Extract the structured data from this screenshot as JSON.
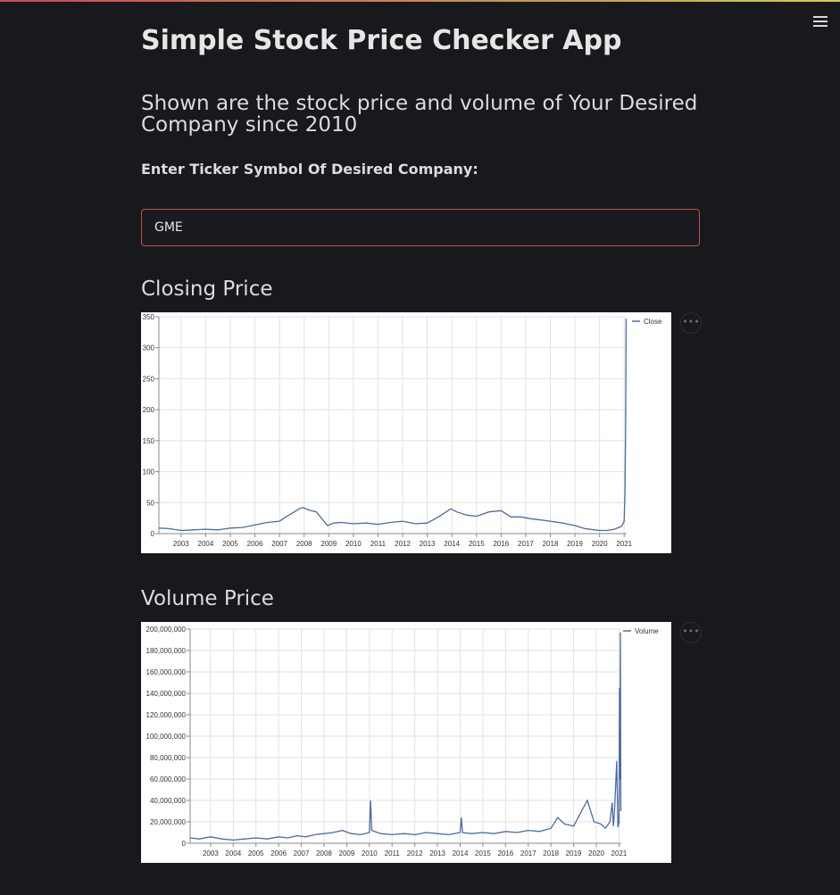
{
  "app": {
    "title": "Simple Stock Price Checker App",
    "subtitle": "Shown are the stock price and volume of Your Desired Company since 2010",
    "input_label": "Enter Ticker Symbol Of Desired Company:",
    "ticker_value": "GME",
    "menu_icon": "hamburger-menu-icon",
    "more_icon": "more-horizontal-icon"
  },
  "closing": {
    "heading": "Closing Price"
  },
  "volume": {
    "heading": "Volume Price"
  },
  "chart_data": [
    {
      "type": "line",
      "legend": [
        "Close"
      ],
      "legend_position": "top-right",
      "grid": true,
      "xlim": [
        2002.1,
        2021.1
      ],
      "ylim": [
        0,
        350
      ],
      "x_ticks": [
        "2003",
        "2004",
        "2005",
        "2006",
        "2007",
        "2008",
        "2009",
        "2010",
        "2011",
        "2012",
        "2013",
        "2014",
        "2015",
        "2016",
        "2017",
        "2018",
        "2019",
        "2020",
        "2021"
      ],
      "y_ticks": [
        "0",
        "50",
        "100",
        "150",
        "200",
        "250",
        "300",
        "350"
      ],
      "series": [
        {
          "name": "Close",
          "color": "#4c6aa3",
          "x": [
            2002.1,
            2002.5,
            2003.0,
            2003.5,
            2004.0,
            2004.5,
            2005.0,
            2005.5,
            2006.0,
            2006.5,
            2007.0,
            2007.3,
            2007.6,
            2007.8,
            2007.95,
            2008.2,
            2008.5,
            2008.8,
            2008.95,
            2009.2,
            2009.5,
            2010.0,
            2010.5,
            2011.0,
            2011.5,
            2012.0,
            2012.5,
            2013.0,
            2013.5,
            2013.95,
            2014.2,
            2014.6,
            2015.0,
            2015.5,
            2016.0,
            2016.4,
            2016.8,
            2017.2,
            2017.6,
            2018.0,
            2018.5,
            2019.0,
            2019.4,
            2019.8,
            2020.0,
            2020.3,
            2020.6,
            2020.9,
            2021.0,
            2021.03,
            2021.06,
            2021.08
          ],
          "y": [
            9,
            8,
            5,
            6,
            7,
            6,
            9,
            10,
            14,
            18,
            20,
            28,
            35,
            40,
            42,
            38,
            35,
            20,
            13,
            17,
            18,
            16,
            17,
            15,
            18,
            20,
            16,
            17,
            28,
            40,
            35,
            30,
            28,
            35,
            37,
            27,
            27,
            24,
            22,
            20,
            17,
            13,
            8,
            6,
            5,
            5,
            7,
            12,
            20,
            65,
            180,
            347
          ]
        }
      ]
    },
    {
      "type": "line",
      "legend": [
        "Volume"
      ],
      "legend_position": "top-right",
      "grid": true,
      "xlim": [
        2002.1,
        2021.1
      ],
      "ylim": [
        0,
        200000000
      ],
      "x_ticks": [
        "2003",
        "2004",
        "2005",
        "2006",
        "2007",
        "2008",
        "2009",
        "2010",
        "2011",
        "2012",
        "2013",
        "2014",
        "2015",
        "2016",
        "2017",
        "2018",
        "2019",
        "2020",
        "2021"
      ],
      "y_ticks": [
        "0",
        "20,000,000",
        "40,000,000",
        "60,000,000",
        "80,000,000",
        "100,000,000",
        "120,000,000",
        "140,000,000",
        "160,000,000",
        "180,000,000",
        "200,000,000"
      ],
      "series": [
        {
          "name": "Volume",
          "color": "#4c6aa3",
          "x": [
            2002.1,
            2002.5,
            2003.0,
            2003.5,
            2004.0,
            2004.5,
            2005.0,
            2005.5,
            2006.0,
            2006.4,
            2006.8,
            2007.2,
            2007.6,
            2008.0,
            2008.4,
            2008.8,
            2009.2,
            2009.6,
            2010.0,
            2010.05,
            2010.1,
            2010.5,
            2011.0,
            2011.5,
            2012.0,
            2012.5,
            2013.0,
            2013.5,
            2014.0,
            2014.05,
            2014.1,
            2014.5,
            2015.0,
            2015.5,
            2016.0,
            2016.5,
            2017.0,
            2017.5,
            2018.0,
            2018.3,
            2018.6,
            2019.0,
            2019.3,
            2019.6,
            2019.9,
            2020.2,
            2020.4,
            2020.6,
            2020.7,
            2020.75,
            2020.8,
            2020.9,
            2020.95,
            2021.0,
            2021.02,
            2021.04,
            2021.06,
            2021.08
          ],
          "y": [
            5000000,
            4000000,
            6000000,
            4000000,
            3000000,
            4000000,
            5000000,
            4000000,
            6000000,
            5000000,
            7000000,
            6000000,
            8000000,
            9000000,
            10000000,
            12000000,
            9000000,
            8000000,
            10000000,
            40000000,
            12000000,
            9000000,
            8000000,
            9000000,
            8000000,
            10000000,
            9000000,
            8000000,
            10000000,
            24000000,
            10000000,
            9000000,
            10000000,
            9000000,
            11000000,
            10000000,
            12000000,
            11000000,
            14000000,
            24000000,
            18000000,
            16000000,
            28000000,
            40000000,
            20000000,
            18000000,
            14000000,
            20000000,
            38000000,
            16000000,
            30000000,
            77000000,
            15000000,
            20000000,
            145000000,
            60000000,
            197000000,
            30000000
          ]
        }
      ]
    }
  ]
}
